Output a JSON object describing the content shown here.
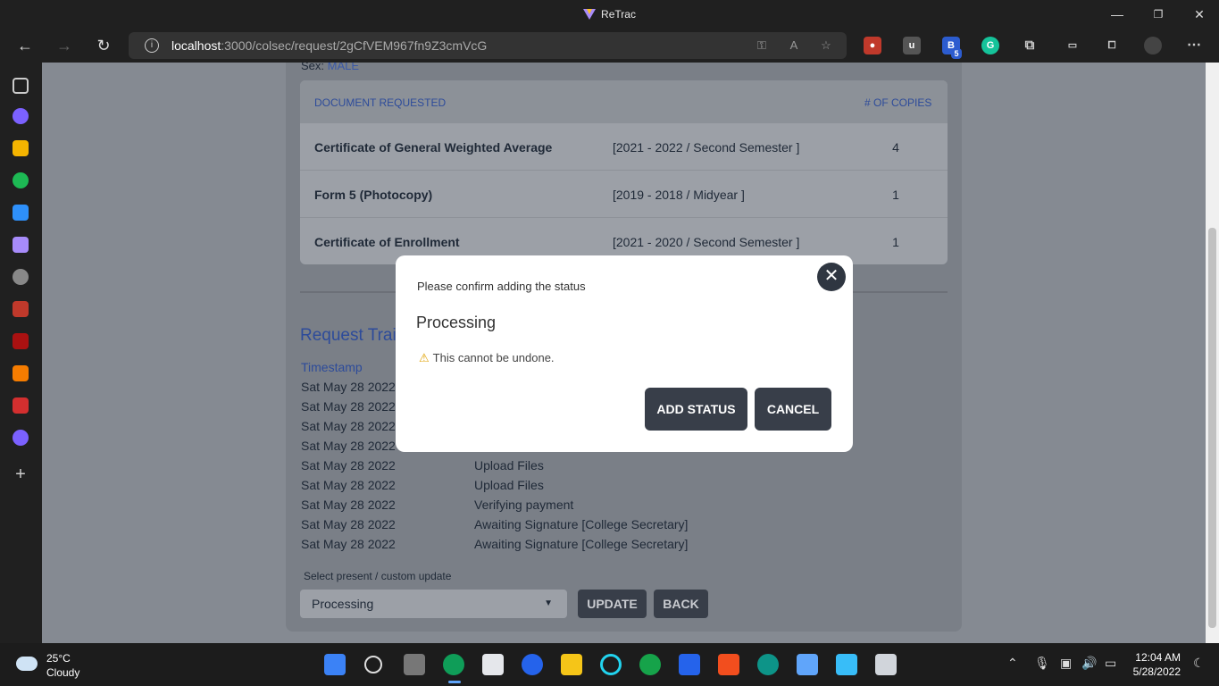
{
  "window": {
    "title": "ReTrac"
  },
  "browser": {
    "url_host": "localhost",
    "url_path": ":3000/colsec/request/2gCfVEM967fn9Z3cmVcG",
    "badge_count": "5"
  },
  "request": {
    "sex_label": "Sex:",
    "sex_value": "MALE",
    "table_headers": {
      "document": "DOCUMENT REQUESTED",
      "copies": "# OF COPIES"
    },
    "documents": [
      {
        "name": "Certificate of General Weighted Average",
        "semester": "[2021 - 2022 / Second Semester ]",
        "copies": "4"
      },
      {
        "name": "Form 5 (Photocopy)",
        "semester": "[2019 - 2018 / Midyear ]",
        "copies": "1"
      },
      {
        "name": "Certificate of Enrollment",
        "semester": "[2021 - 2020 / Second Semester ]",
        "copies": "1"
      }
    ]
  },
  "trail": {
    "title": "Request Trail",
    "timestamp_header": "Timestamp",
    "rows": [
      {
        "timestamp": "Sat May 28 2022",
        "status": ""
      },
      {
        "timestamp": "Sat May 28 2022",
        "status": ""
      },
      {
        "timestamp": "Sat May 28 2022",
        "status": ""
      },
      {
        "timestamp": "Sat May 28 2022",
        "status": ""
      },
      {
        "timestamp": "Sat May 28 2022",
        "status": "Upload Files"
      },
      {
        "timestamp": "Sat May 28 2022",
        "status": "Upload Files"
      },
      {
        "timestamp": "Sat May 28 2022",
        "status": "Verifying payment"
      },
      {
        "timestamp": "Sat May 28 2022",
        "status": "Awaiting Signature [College Secretary]"
      },
      {
        "timestamp": "Sat May 28 2022",
        "status": "Awaiting Signature [College Secretary]"
      }
    ]
  },
  "update_form": {
    "label": "Select present / custom update",
    "selected": "Processing",
    "update_button": "UPDATE",
    "back_button": "BACK"
  },
  "modal": {
    "confirm_text": "Please confirm adding the status",
    "status": "Processing",
    "warning": "This cannot be undone.",
    "add_button": "ADD STATUS",
    "cancel_button": "CANCEL",
    "close_glyph": "✕"
  },
  "taskbar": {
    "temperature": "25°C",
    "weather": "Cloudy",
    "time": "12:04 AM",
    "date": "5/28/2022"
  },
  "colors": {
    "accent_blue": "#2d4b9a",
    "button_dark": "#383e49",
    "overlay_bg": "#858a92"
  }
}
